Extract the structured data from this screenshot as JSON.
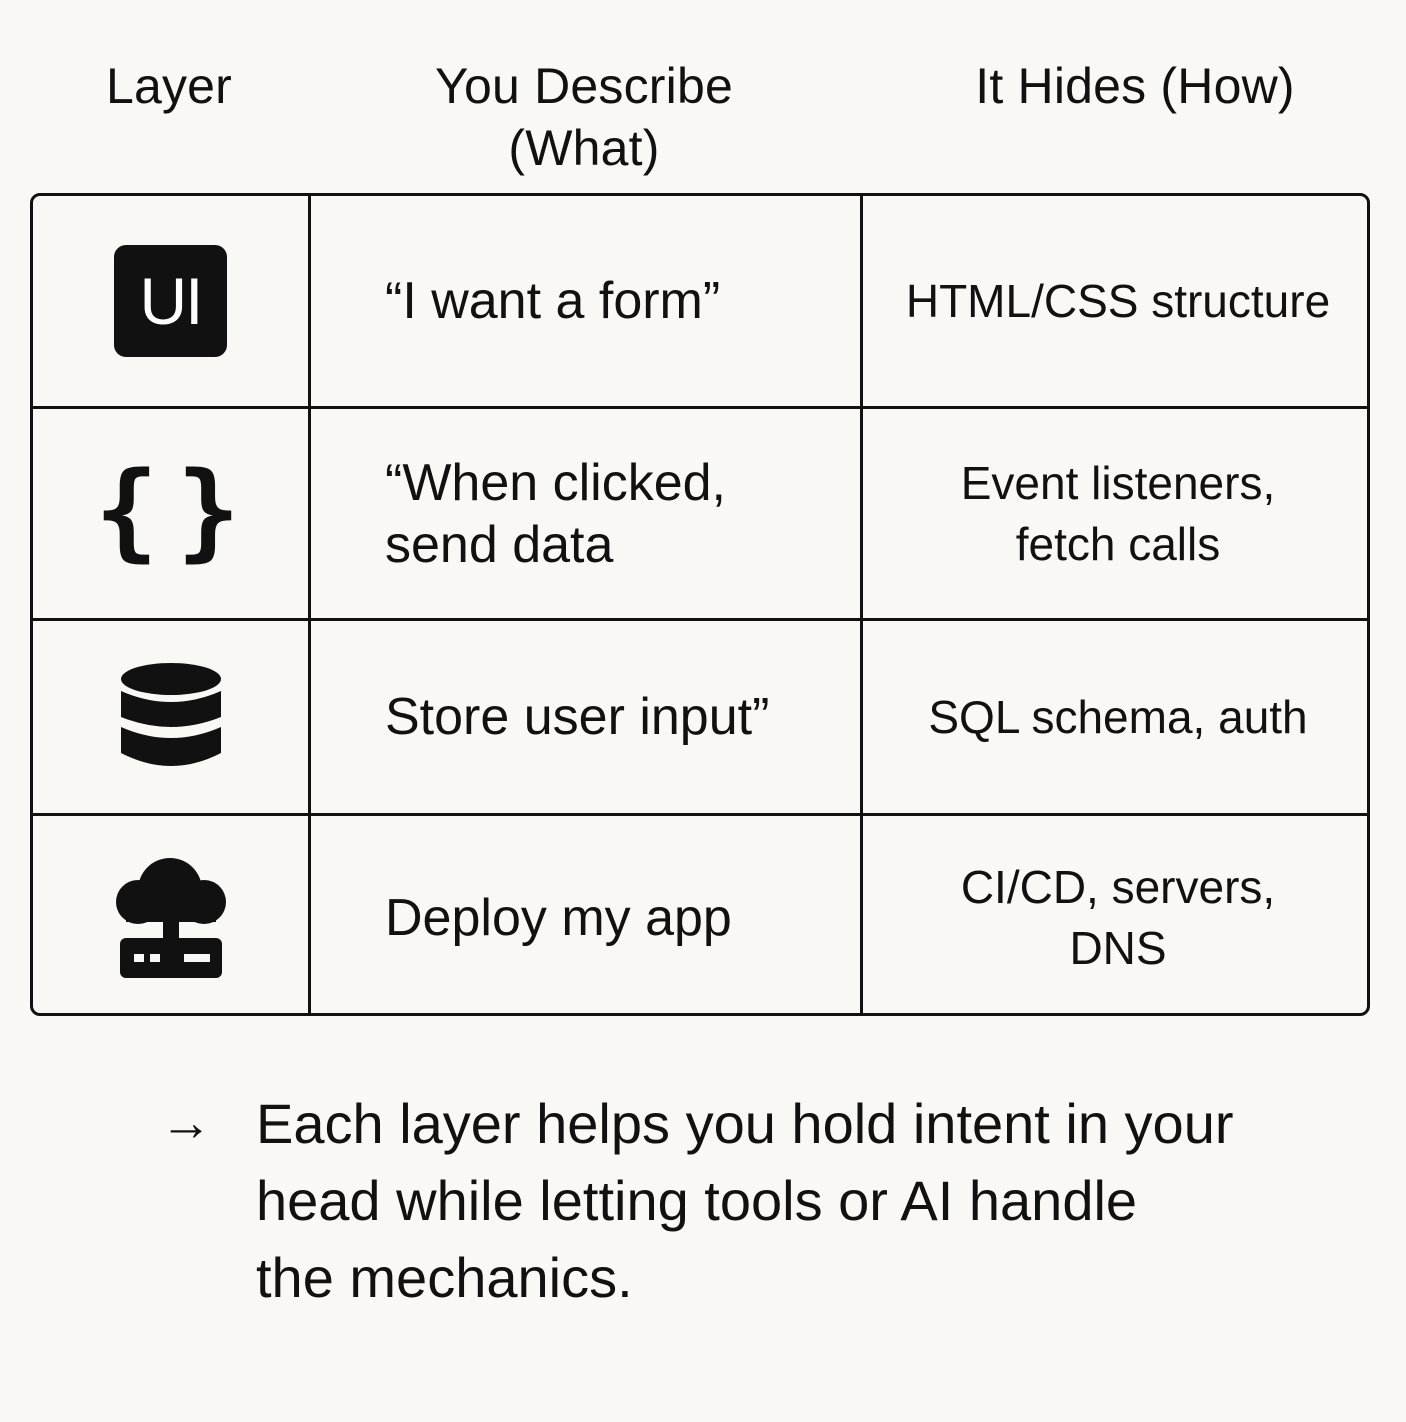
{
  "headers": {
    "layer": "Layer",
    "what": "You Describe\n(What)",
    "how": "It Hides (How)"
  },
  "rows": [
    {
      "icon": "ui-icon",
      "icon_text": "UI",
      "what": "“I want a form”",
      "how": "HTML/CSS structure"
    },
    {
      "icon": "curly-braces-icon",
      "icon_text": "{}",
      "what": "“When clicked,\n send data",
      "how": "Event listeners,\nfetch calls"
    },
    {
      "icon": "database-icon",
      "what": "Store user input”",
      "how": "SQL schema, auth"
    },
    {
      "icon": "cloud-server-icon",
      "what": "Deploy my app",
      "how": "CI/CD, servers,\nDNS"
    }
  ],
  "footer": {
    "arrow": "→",
    "text": "Each layer helps you hold intent in your\nhead while letting tools or AI handle\nthe mechanics."
  }
}
